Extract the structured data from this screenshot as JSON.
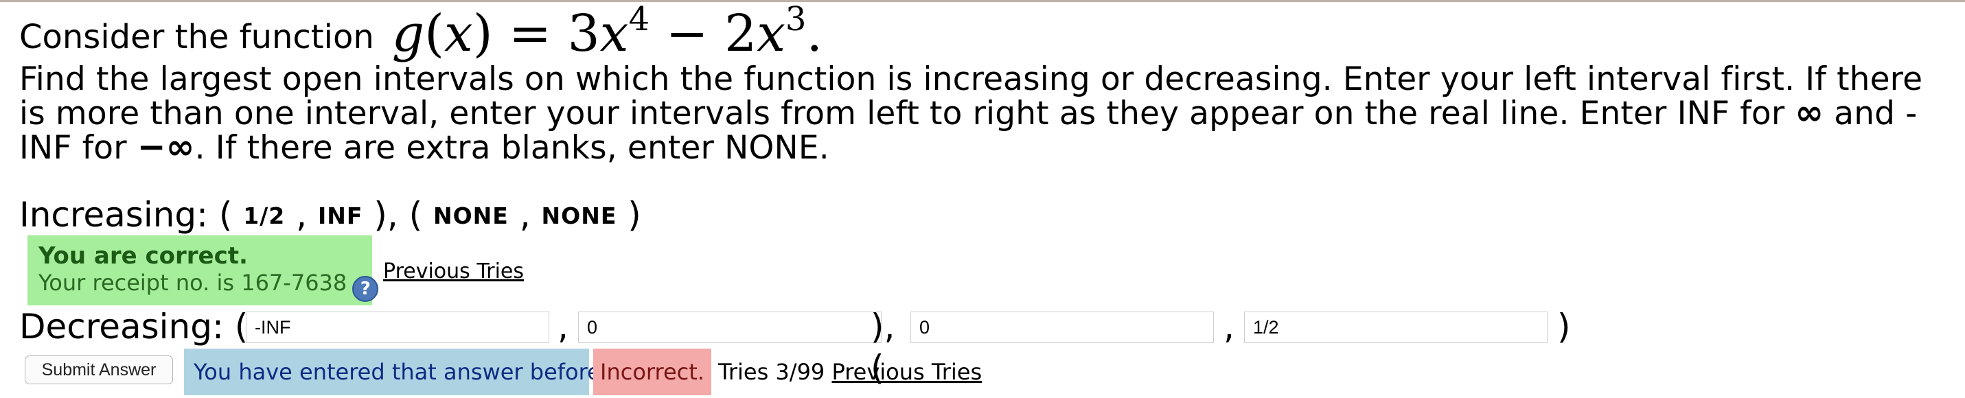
{
  "problem": {
    "lead": "Consider the function",
    "function_name": "g",
    "function_var": "x",
    "coef1": "3",
    "exp1": "4",
    "coef2": "2",
    "exp2": "3",
    "instructions": "Find the largest open intervals on which the function is increasing or decreasing. Enter your left interval first. If there is more than one interval, enter your intervals from left to right as they appear on the real line. Enter INF for",
    "instructions_mid": "and -INF for",
    "instructions_end": ". If there are extra blanks, enter NONE."
  },
  "increasing": {
    "label": "Increasing:",
    "interval1_left": "1/2",
    "interval1_right": "INF",
    "interval2_left": "NONE",
    "interval2_right": "NONE",
    "status_title": "You are correct.",
    "receipt": "Your receipt no. is 167-7638",
    "previous_tries": "Previous Tries"
  },
  "decreasing": {
    "label": "Decreasing:",
    "interval1_left": "-INF",
    "interval1_right": "0",
    "interval2_left": "0",
    "interval2_right": "1/2"
  },
  "footer": {
    "submit_label": "Submit Answer",
    "duplicate_msg": "You have entered that answer before",
    "incorrect_msg": "Incorrect.",
    "tries_text": "Tries 3/99",
    "previous_tries": "Previous Tries"
  },
  "colors": {
    "correct_bg": "#a6ee9c",
    "duplicate_bg": "#add3e3",
    "incorrect_bg": "#f3aaa8",
    "help_icon": "#4d79b8"
  },
  "icons": {
    "help": "question-circle-icon"
  }
}
